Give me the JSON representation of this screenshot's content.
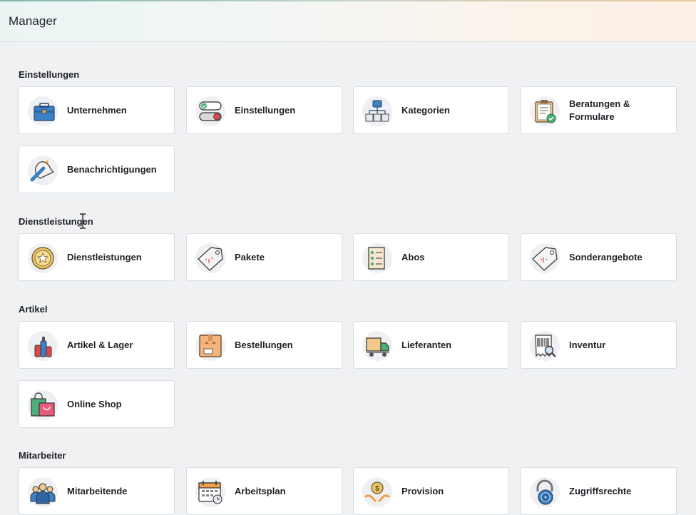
{
  "header": {
    "title": "Manager"
  },
  "sections": {
    "einstellungen": {
      "title": "Einstellungen",
      "items": [
        {
          "label": "Unternehmen",
          "icon": "briefcase-icon"
        },
        {
          "label": "Einstellungen",
          "icon": "toggle-switches-icon"
        },
        {
          "label": "Kategorien",
          "icon": "hierarchy-icon"
        },
        {
          "label": "Beratungen & Formulare",
          "icon": "clipboard-check-icon"
        },
        {
          "label": "Benachrichtigungen",
          "icon": "bell-icon"
        }
      ]
    },
    "dienstleistungen": {
      "title": "Dienstleistungen",
      "items": [
        {
          "label": "Dienstleistungen",
          "icon": "star-medal-icon"
        },
        {
          "label": "Pakete",
          "icon": "price-tag-icon"
        },
        {
          "label": "Abos",
          "icon": "checklist-icon"
        },
        {
          "label": "Sonderangebote",
          "icon": "discount-tag-icon"
        }
      ]
    },
    "artikel": {
      "title": "Artikel",
      "items": [
        {
          "label": "Artikel & Lager",
          "icon": "products-icon"
        },
        {
          "label": "Bestellungen",
          "icon": "parcel-box-icon"
        },
        {
          "label": "Lieferanten",
          "icon": "delivery-truck-icon"
        },
        {
          "label": "Inventur",
          "icon": "barcode-search-icon"
        },
        {
          "label": "Online Shop",
          "icon": "shopping-bag-icon"
        }
      ]
    },
    "mitarbeiter": {
      "title": "Mitarbeiter",
      "items": [
        {
          "label": "Mitarbeitende",
          "icon": "team-icon"
        },
        {
          "label": "Arbeitsplan",
          "icon": "calendar-icon"
        },
        {
          "label": "Provision",
          "icon": "coin-hands-icon"
        },
        {
          "label": "Zugriffsrechte",
          "icon": "padlock-icon"
        }
      ]
    }
  },
  "colors": {
    "background": "#f0f1f3",
    "card": "#ffffff",
    "card_border": "#d7dde6",
    "text": "#1e2126",
    "icon_blue": "#3b7fc4",
    "icon_orange": "#f0a04b",
    "icon_green": "#4caf7a",
    "icon_red": "#e04848"
  }
}
